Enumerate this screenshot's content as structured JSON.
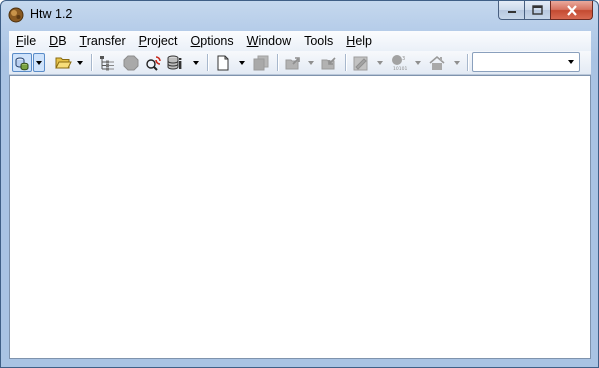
{
  "window": {
    "title": "Htw 1.2",
    "app_icon": "htw-app-icon"
  },
  "caption_buttons": {
    "minimize": "minimize-icon",
    "maximize": "maximize-icon",
    "close": "close-icon"
  },
  "menu": {
    "items": [
      {
        "label": "File",
        "accel": "F",
        "rest": "ile"
      },
      {
        "label": "DB",
        "accel": "D",
        "rest": "B"
      },
      {
        "label": "Transfer",
        "accel": "T",
        "rest": "ransfer"
      },
      {
        "label": "Project",
        "accel": "P",
        "rest": "roject"
      },
      {
        "label": "Options",
        "accel": "O",
        "rest": "ptions"
      },
      {
        "label": "Window",
        "accel": "W",
        "rest": "indow"
      },
      {
        "label": "Tools",
        "accel": "",
        "rest": "Tools"
      },
      {
        "label": "Help",
        "accel": "H",
        "rest": "elp"
      }
    ]
  },
  "toolbar": {
    "buttons": [
      {
        "icon": "database-connect-icon",
        "state": "pressed"
      },
      {
        "icon": "open-folder-icon",
        "state": "enabled"
      },
      {
        "icon": "tree-hierarchy-icon",
        "state": "enabled"
      },
      {
        "icon": "stop-hexagon-icon",
        "state": "disabled"
      },
      {
        "icon": "search-refresh-icon",
        "state": "enabled"
      },
      {
        "icon": "database-info-icon",
        "state": "enabled"
      },
      {
        "icon": "new-document-icon",
        "state": "enabled"
      },
      {
        "icon": "copy-documents-icon",
        "state": "disabled"
      },
      {
        "icon": "export-icon",
        "state": "disabled"
      },
      {
        "icon": "import-icon",
        "state": "disabled"
      },
      {
        "icon": "edit-form-icon",
        "state": "disabled"
      },
      {
        "icon": "sequence-icon",
        "state": "disabled"
      },
      {
        "icon": "home-icon",
        "state": "disabled"
      }
    ],
    "combo_value": ""
  },
  "colors": {
    "frame": "#a9c3e3",
    "close_button": "#c44a31",
    "client": "#ffffff"
  }
}
